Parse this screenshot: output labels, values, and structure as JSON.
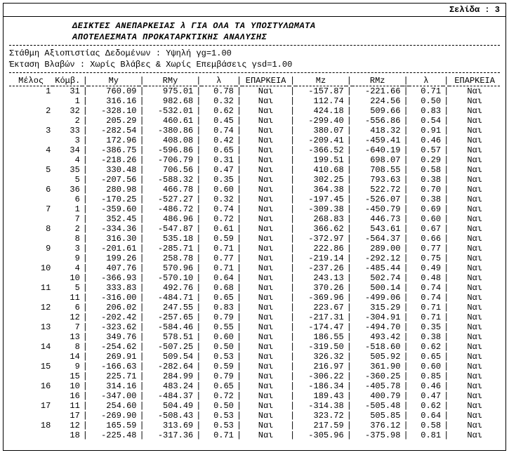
{
  "page_label": "Σελίδα : 3",
  "title1": "ΔΕΙΚΤΕΣ ΑΝΕΠΑΡΚΕΙΑΣ λ ΓΙΑ ΟΛΑ ΤΑ ΥΠΟΣΤΥΛΩΜΑΤΑ",
  "title2": "ΑΠΟΤΕΛΕΣΜΑΤΑ ΠΡΟΚΑΤΑΡΚΤΙΚΗΣ ΑΝΑΛΥΣΗΣ",
  "meta1": "Στάθμη Αξιοπιστίας Δεδομένων : Υψηλή γg=1.00",
  "meta2": "Έκταση Βλαβών : Χωρίς Βλάβες & Χωρίς Επεμβάσεις γsd=1.00",
  "headers": {
    "melos": "Μέλος",
    "komv": "Κόμβ.",
    "my": "My",
    "rmy": "RMy",
    "lambda": "λ",
    "eparkeia": "ΕΠΑΡΚΕΙΑ",
    "mz": "Mz",
    "rmz": "RMz"
  },
  "sep": "|",
  "rows": [
    {
      "mel": "1",
      "kom": "31",
      "my": "760.09",
      "rmy": "975.01",
      "l1": "0.78",
      "e1": "Ναι",
      "mz": "-157.87",
      "rmz": "-221.66",
      "l2": "0.71",
      "e2": "Ναι"
    },
    {
      "mel": "",
      "kom": "1",
      "my": "316.16",
      "rmy": "982.68",
      "l1": "0.32",
      "e1": "Ναι",
      "mz": "112.74",
      "rmz": "224.56",
      "l2": "0.50",
      "e2": "Ναι"
    },
    {
      "mel": "2",
      "kom": "32",
      "my": "-328.10",
      "rmy": "-532.01",
      "l1": "0.62",
      "e1": "Ναι",
      "mz": "424.18",
      "rmz": "509.66",
      "l2": "0.83",
      "e2": "Ναι"
    },
    {
      "mel": "",
      "kom": "2",
      "my": "205.29",
      "rmy": "460.61",
      "l1": "0.45",
      "e1": "Ναι",
      "mz": "-299.40",
      "rmz": "-556.86",
      "l2": "0.54",
      "e2": "Ναι"
    },
    {
      "mel": "3",
      "kom": "33",
      "my": "-282.54",
      "rmy": "-380.86",
      "l1": "0.74",
      "e1": "Ναι",
      "mz": "380.07",
      "rmz": "418.32",
      "l2": "0.91",
      "e2": "Ναι"
    },
    {
      "mel": "",
      "kom": "3",
      "my": "172.96",
      "rmy": "408.08",
      "l1": "0.42",
      "e1": "Ναι",
      "mz": "-209.41",
      "rmz": "-459.41",
      "l2": "0.46",
      "e2": "Ναι"
    },
    {
      "mel": "4",
      "kom": "34",
      "my": "-386.75",
      "rmy": "-596.86",
      "l1": "0.65",
      "e1": "Ναι",
      "mz": "-366.52",
      "rmz": "-640.19",
      "l2": "0.57",
      "e2": "Ναι"
    },
    {
      "mel": "",
      "kom": "4",
      "my": "-218.26",
      "rmy": "-706.79",
      "l1": "0.31",
      "e1": "Ναι",
      "mz": "199.51",
      "rmz": "698.07",
      "l2": "0.29",
      "e2": "Ναι"
    },
    {
      "mel": "5",
      "kom": "35",
      "my": "330.48",
      "rmy": "706.56",
      "l1": "0.47",
      "e1": "Ναι",
      "mz": "410.68",
      "rmz": "708.55",
      "l2": "0.58",
      "e2": "Ναι"
    },
    {
      "mel": "",
      "kom": "5",
      "my": "-207.56",
      "rmy": "-588.32",
      "l1": "0.35",
      "e1": "Ναι",
      "mz": "302.25",
      "rmz": "793.63",
      "l2": "0.38",
      "e2": "Ναι"
    },
    {
      "mel": "6",
      "kom": "36",
      "my": "280.98",
      "rmy": "466.78",
      "l1": "0.60",
      "e1": "Ναι",
      "mz": "364.38",
      "rmz": "522.72",
      "l2": "0.70",
      "e2": "Ναι"
    },
    {
      "mel": "",
      "kom": "6",
      "my": "-170.25",
      "rmy": "-527.27",
      "l1": "0.32",
      "e1": "Ναι",
      "mz": "-197.45",
      "rmz": "-526.07",
      "l2": "0.38",
      "e2": "Ναι"
    },
    {
      "mel": "7",
      "kom": "1",
      "my": "-359.60",
      "rmy": "-486.72",
      "l1": "0.74",
      "e1": "Ναι",
      "mz": "-309.38",
      "rmz": "-450.79",
      "l2": "0.69",
      "e2": "Ναι"
    },
    {
      "mel": "",
      "kom": "7",
      "my": "352.45",
      "rmy": "486.96",
      "l1": "0.72",
      "e1": "Ναι",
      "mz": "268.83",
      "rmz": "446.73",
      "l2": "0.60",
      "e2": "Ναι"
    },
    {
      "mel": "8",
      "kom": "2",
      "my": "-334.36",
      "rmy": "-547.87",
      "l1": "0.61",
      "e1": "Ναι",
      "mz": "366.62",
      "rmz": "543.61",
      "l2": "0.67",
      "e2": "Ναι"
    },
    {
      "mel": "",
      "kom": "8",
      "my": "316.30",
      "rmy": "535.18",
      "l1": "0.59",
      "e1": "Ναι",
      "mz": "-372.97",
      "rmz": "-564.37",
      "l2": "0.66",
      "e2": "Ναι"
    },
    {
      "mel": "9",
      "kom": "3",
      "my": "-201.61",
      "rmy": "-285.71",
      "l1": "0.71",
      "e1": "Ναι",
      "mz": "222.86",
      "rmz": "289.00",
      "l2": "0.77",
      "e2": "Ναι"
    },
    {
      "mel": "",
      "kom": "9",
      "my": "199.26",
      "rmy": "258.78",
      "l1": "0.77",
      "e1": "Ναι",
      "mz": "-219.14",
      "rmz": "-292.12",
      "l2": "0.75",
      "e2": "Ναι"
    },
    {
      "mel": "10",
      "kom": "4",
      "my": "407.76",
      "rmy": "570.96",
      "l1": "0.71",
      "e1": "Ναι",
      "mz": "-237.26",
      "rmz": "-485.44",
      "l2": "0.49",
      "e2": "Ναι"
    },
    {
      "mel": "",
      "kom": "10",
      "my": "-366.93",
      "rmy": "-570.10",
      "l1": "0.64",
      "e1": "Ναι",
      "mz": "243.13",
      "rmz": "502.74",
      "l2": "0.48",
      "e2": "Ναι"
    },
    {
      "mel": "11",
      "kom": "5",
      "my": "333.83",
      "rmy": "492.76",
      "l1": "0.68",
      "e1": "Ναι",
      "mz": "370.26",
      "rmz": "500.14",
      "l2": "0.74",
      "e2": "Ναι"
    },
    {
      "mel": "",
      "kom": "11",
      "my": "-316.00",
      "rmy": "-484.71",
      "l1": "0.65",
      "e1": "Ναι",
      "mz": "-369.96",
      "rmz": "-499.06",
      "l2": "0.74",
      "e2": "Ναι"
    },
    {
      "mel": "12",
      "kom": "6",
      "my": "206.02",
      "rmy": "247.55",
      "l1": "0.83",
      "e1": "Ναι",
      "mz": "223.67",
      "rmz": "315.29",
      "l2": "0.71",
      "e2": "Ναι"
    },
    {
      "mel": "",
      "kom": "12",
      "my": "-202.42",
      "rmy": "-257.65",
      "l1": "0.79",
      "e1": "Ναι",
      "mz": "-217.31",
      "rmz": "-304.91",
      "l2": "0.71",
      "e2": "Ναι"
    },
    {
      "mel": "13",
      "kom": "7",
      "my": "-323.62",
      "rmy": "-584.46",
      "l1": "0.55",
      "e1": "Ναι",
      "mz": "-174.47",
      "rmz": "-494.70",
      "l2": "0.35",
      "e2": "Ναι"
    },
    {
      "mel": "",
      "kom": "13",
      "my": "349.76",
      "rmy": "578.51",
      "l1": "0.60",
      "e1": "Ναι",
      "mz": "186.55",
      "rmz": "493.42",
      "l2": "0.38",
      "e2": "Ναι"
    },
    {
      "mel": "14",
      "kom": "8",
      "my": "-254.62",
      "rmy": "-507.25",
      "l1": "0.50",
      "e1": "Ναι",
      "mz": "-319.50",
      "rmz": "-518.60",
      "l2": "0.62",
      "e2": "Ναι"
    },
    {
      "mel": "",
      "kom": "14",
      "my": "269.91",
      "rmy": "509.54",
      "l1": "0.53",
      "e1": "Ναι",
      "mz": "326.32",
      "rmz": "505.92",
      "l2": "0.65",
      "e2": "Ναι"
    },
    {
      "mel": "15",
      "kom": "9",
      "my": "-166.63",
      "rmy": "-282.64",
      "l1": "0.59",
      "e1": "Ναι",
      "mz": "216.97",
      "rmz": "361.90",
      "l2": "0.60",
      "e2": "Ναι"
    },
    {
      "mel": "",
      "kom": "15",
      "my": "225.71",
      "rmy": "284.99",
      "l1": "0.79",
      "e1": "Ναι",
      "mz": "-306.22",
      "rmz": "-360.25",
      "l2": "0.85",
      "e2": "Ναι"
    },
    {
      "mel": "16",
      "kom": "10",
      "my": "314.16",
      "rmy": "483.24",
      "l1": "0.65",
      "e1": "Ναι",
      "mz": "-186.34",
      "rmz": "-405.78",
      "l2": "0.46",
      "e2": "Ναι"
    },
    {
      "mel": "",
      "kom": "16",
      "my": "-347.00",
      "rmy": "-484.37",
      "l1": "0.72",
      "e1": "Ναι",
      "mz": "189.43",
      "rmz": "400.79",
      "l2": "0.47",
      "e2": "Ναι"
    },
    {
      "mel": "17",
      "kom": "11",
      "my": "254.60",
      "rmy": "504.49",
      "l1": "0.50",
      "e1": "Ναι",
      "mz": "-314.38",
      "rmz": "-505.48",
      "l2": "0.62",
      "e2": "Ναι"
    },
    {
      "mel": "",
      "kom": "17",
      "my": "-269.90",
      "rmy": "-508.43",
      "l1": "0.53",
      "e1": "Ναι",
      "mz": "323.72",
      "rmz": "505.85",
      "l2": "0.64",
      "e2": "Ναι"
    },
    {
      "mel": "18",
      "kom": "12",
      "my": "165.59",
      "rmy": "313.69",
      "l1": "0.53",
      "e1": "Ναι",
      "mz": "217.59",
      "rmz": "376.12",
      "l2": "0.58",
      "e2": "Ναι"
    },
    {
      "mel": "",
      "kom": "18",
      "my": "-225.48",
      "rmy": "-317.36",
      "l1": "0.71",
      "e1": "Ναι",
      "mz": "-305.96",
      "rmz": "-375.98",
      "l2": "0.81",
      "e2": "Ναι"
    }
  ]
}
